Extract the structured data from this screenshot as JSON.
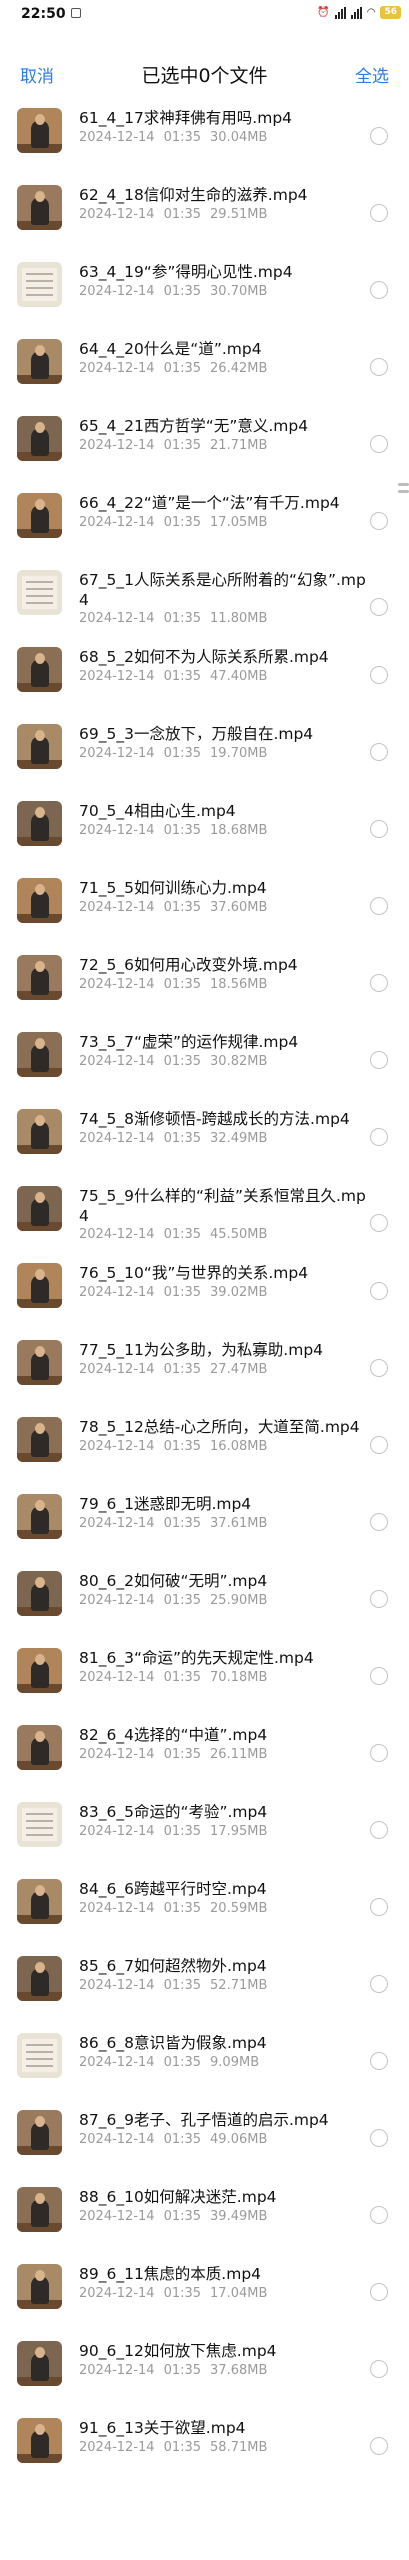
{
  "status": {
    "time": "22:50",
    "battery": "56"
  },
  "header": {
    "cancel": "取消",
    "title": "已选中0个文件",
    "select_all": "全选"
  },
  "files": [
    {
      "name": "61_4_17求神拜佛有用吗.mp4",
      "date": "2024-12-14",
      "time": "01:35",
      "size": "30.04MB",
      "thumb": "person"
    },
    {
      "name": "62_4_18信仰对生命的滋养.mp4",
      "date": "2024-12-14",
      "time": "01:35",
      "size": "29.51MB",
      "thumb": "person"
    },
    {
      "name": "63_4_19“参”得明心见性.mp4",
      "date": "2024-12-14",
      "time": "01:35",
      "size": "30.70MB",
      "thumb": "paper"
    },
    {
      "name": "64_4_20什么是“道”.mp4",
      "date": "2024-12-14",
      "time": "01:35",
      "size": "26.42MB",
      "thumb": "person"
    },
    {
      "name": "65_4_21西方哲学“无”意义.mp4",
      "date": "2024-12-14",
      "time": "01:35",
      "size": "21.71MB",
      "thumb": "person"
    },
    {
      "name": "66_4_22“道”是一个“法”有千万.mp4",
      "date": "2024-12-14",
      "time": "01:35",
      "size": "17.05MB",
      "thumb": "person"
    },
    {
      "name": "67_5_1人际关系是心所附着的“幻象”.mp4",
      "date": "2024-12-14",
      "time": "01:35",
      "size": "11.80MB",
      "thumb": "paper"
    },
    {
      "name": "68_5_2如何不为人际关系所累.mp4",
      "date": "2024-12-14",
      "time": "01:35",
      "size": "47.40MB",
      "thumb": "person"
    },
    {
      "name": "69_5_3一念放下，万般自在.mp4",
      "date": "2024-12-14",
      "time": "01:35",
      "size": "19.70MB",
      "thumb": "person"
    },
    {
      "name": "70_5_4相由心生.mp4",
      "date": "2024-12-14",
      "time": "01:35",
      "size": "18.68MB",
      "thumb": "person"
    },
    {
      "name": "71_5_5如何训练心力.mp4",
      "date": "2024-12-14",
      "time": "01:35",
      "size": "37.60MB",
      "thumb": "person"
    },
    {
      "name": "72_5_6如何用心改变外境.mp4",
      "date": "2024-12-14",
      "time": "01:35",
      "size": "18.56MB",
      "thumb": "person"
    },
    {
      "name": "73_5_7“虚荣”的运作规律.mp4",
      "date": "2024-12-14",
      "time": "01:35",
      "size": "30.82MB",
      "thumb": "person"
    },
    {
      "name": "74_5_8渐修顿悟-跨越成长的方法.mp4",
      "date": "2024-12-14",
      "time": "01:35",
      "size": "32.49MB",
      "thumb": "person"
    },
    {
      "name": "75_5_9什么样的“利益”关系恒常且久.mp4",
      "date": "2024-12-14",
      "time": "01:35",
      "size": "45.50MB",
      "thumb": "person"
    },
    {
      "name": "76_5_10“我”与世界的关系.mp4",
      "date": "2024-12-14",
      "time": "01:35",
      "size": "39.02MB",
      "thumb": "person"
    },
    {
      "name": "77_5_11为公多助，为私寡助.mp4",
      "date": "2024-12-14",
      "time": "01:35",
      "size": "27.47MB",
      "thumb": "person"
    },
    {
      "name": "78_5_12总结-心之所向，大道至简.mp4",
      "date": "2024-12-14",
      "time": "01:35",
      "size": "16.08MB",
      "thumb": "person"
    },
    {
      "name": "79_6_1迷惑即无明.mp4",
      "date": "2024-12-14",
      "time": "01:35",
      "size": "37.61MB",
      "thumb": "person"
    },
    {
      "name": "80_6_2如何破“无明”.mp4",
      "date": "2024-12-14",
      "time": "01:35",
      "size": "25.90MB",
      "thumb": "person"
    },
    {
      "name": "81_6_3“命运”的先天规定性.mp4",
      "date": "2024-12-14",
      "time": "01:35",
      "size": "70.18MB",
      "thumb": "person"
    },
    {
      "name": "82_6_4选择的“中道”.mp4",
      "date": "2024-12-14",
      "time": "01:35",
      "size": "26.11MB",
      "thumb": "person"
    },
    {
      "name": "83_6_5命运的“考验”.mp4",
      "date": "2024-12-14",
      "time": "01:35",
      "size": "17.95MB",
      "thumb": "paper"
    },
    {
      "name": "84_6_6跨越平行时空.mp4",
      "date": "2024-12-14",
      "time": "01:35",
      "size": "20.59MB",
      "thumb": "person"
    },
    {
      "name": "85_6_7如何超然物外.mp4",
      "date": "2024-12-14",
      "time": "01:35",
      "size": "52.71MB",
      "thumb": "person"
    },
    {
      "name": "86_6_8意识皆为假象.mp4",
      "date": "2024-12-14",
      "time": "01:35",
      "size": "9.09MB",
      "thumb": "paper"
    },
    {
      "name": "87_6_9老子、孔子悟道的启示.mp4",
      "date": "2024-12-14",
      "time": "01:35",
      "size": "49.06MB",
      "thumb": "person"
    },
    {
      "name": "88_6_10如何解决迷茫.mp4",
      "date": "2024-12-14",
      "time": "01:35",
      "size": "39.49MB",
      "thumb": "person"
    },
    {
      "name": "89_6_11焦虑的本质.mp4",
      "date": "2024-12-14",
      "time": "01:35",
      "size": "17.04MB",
      "thumb": "person"
    },
    {
      "name": "90_6_12如何放下焦虑.mp4",
      "date": "2024-12-14",
      "time": "01:35",
      "size": "37.68MB",
      "thumb": "person"
    },
    {
      "name": "91_6_13关于欲望.mp4",
      "date": "2024-12-14",
      "time": "01:35",
      "size": "58.71MB",
      "thumb": "person"
    }
  ]
}
